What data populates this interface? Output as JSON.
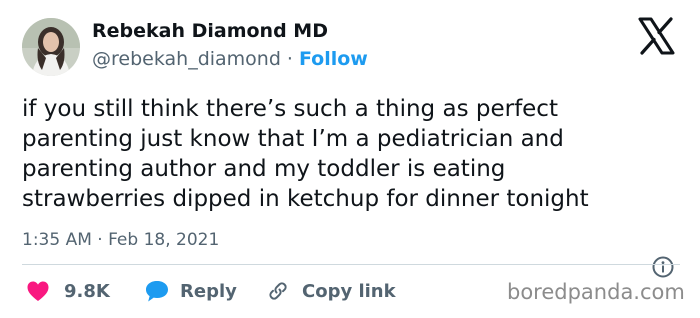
{
  "author": {
    "display_name": "Rebekah Diamond MD",
    "handle": "@rebekah_diamond",
    "separator": "·",
    "follow_label": "Follow"
  },
  "tweet": {
    "text_lines": [
      "if you still think there’s such a thing as perfect",
      "parenting just know that I’m a pediatrician and",
      "parenting author and my toddler is eating",
      "strawberries dipped in ketchup for dinner tonight"
    ],
    "timestamp": "1:35 AM · Feb 18, 2021"
  },
  "actions": {
    "like_count": "9.8K",
    "reply_label": "Reply",
    "copy_link_label": "Copy link"
  },
  "watermark": "boredpanda.com",
  "icons": {
    "platform_logo": "x-logo-icon",
    "like": "heart-icon",
    "reply": "speech-bubble-icon",
    "copy": "link-icon",
    "info": "info-icon"
  },
  "colors": {
    "text_primary": "#0f1419",
    "text_secondary": "#536471",
    "accent_blue": "#1d9bf0",
    "like_red": "#f91880",
    "divider": "#cfd9de",
    "watermark": "#8c8c8c"
  }
}
